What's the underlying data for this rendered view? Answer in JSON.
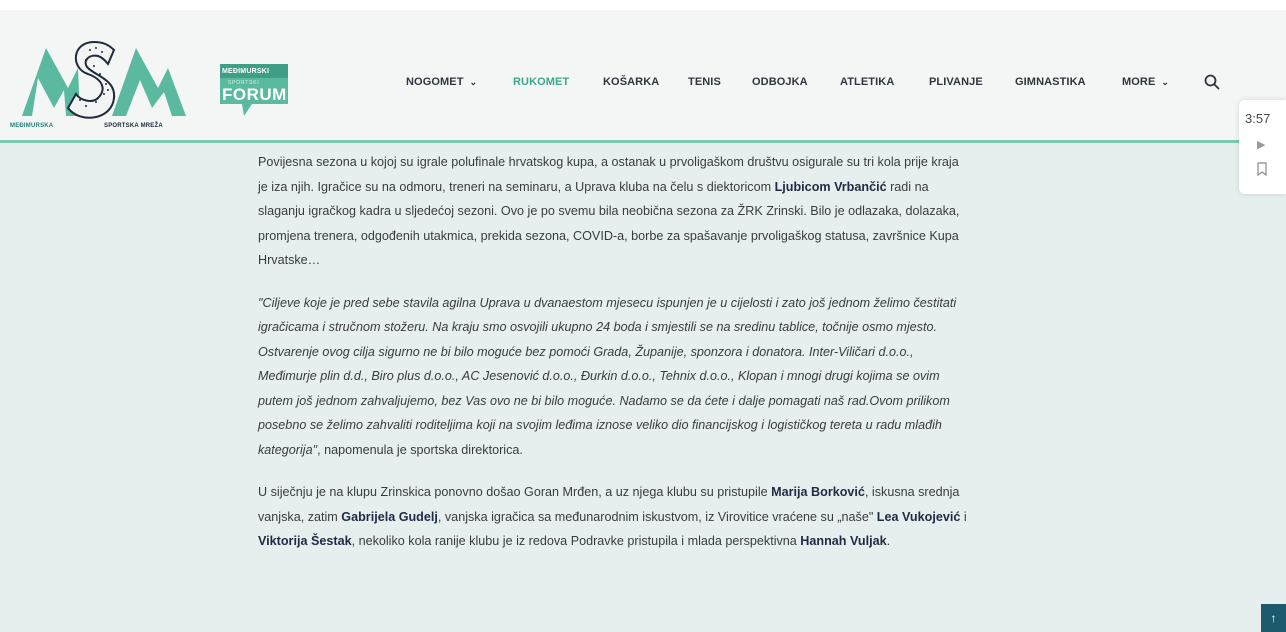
{
  "header": {
    "logo": {
      "left_text": "MEĐIMURSKA",
      "right_text": "SPORTSKA MREŽA",
      "letters": "MSM"
    },
    "forum_logo": {
      "top_text": "MEĐIMURSKI",
      "sub_text": "SPORTSKI",
      "main_text": "FORUM"
    },
    "nav": [
      {
        "label": "NOGOMET",
        "dropdown": true
      },
      {
        "label": "RUKOMET",
        "active": true
      },
      {
        "label": "KOŠARKA"
      },
      {
        "label": "TENIS"
      },
      {
        "label": "ODBOJKA"
      },
      {
        "label": "ATLETIKA"
      },
      {
        "label": "PLIVANJE"
      },
      {
        "label": "GIMNASTIKA"
      },
      {
        "label": "MORE",
        "dropdown": true
      }
    ],
    "search_icon": "search-icon"
  },
  "side_widget": {
    "time": "3:57",
    "play_icon": "play-icon",
    "bookmark_icon": "bookmark-icon"
  },
  "article": {
    "p1": {
      "t1": "Povijesna sezona u kojoj su igrale polufinale hrvatskog kupa, a ostanak u prvoligaškom društvu osigurale su tri kola prije kraja je iza njih. Igračice su na odmoru, treneri na seminaru, a Uprava kluba na čelu s diektoricom ",
      "b1": "Ljubicom Vrbančić",
      "t2": " radi na slaganju igračkog kadra u sljedećoj sezoni. Ovo je po svemu bila neobična sezona za ŽRK Zrinski. Bilo je odlazaka, dolazaka, promjena trenera, odgođenih utakmica, prekida sezona, COVID-a, borbe za spašavanje prvoligaškog statusa, završnice Kupa Hrvatske…"
    },
    "quote": "\"Ciljeve koje je pred sebe stavila agilna Uprava u dvanaestom mjesecu ispunjen je u cijelosti i zato još jednom želimo čestitati igračicama i stručnom stožeru. Na kraju smo osvojili ukupno 24 boda i smjestili se na sredinu tablice, točnije osmo mjesto. Ostvarenje ovog cilja sigurno ne bi bilo moguće bez pomoći Grada, Županije, sponzora i donatora. Inter-Viličari d.o.o., Međimurje plin d.d., Biro plus d.o.o., AC Jesenović d.o.o., Đurkin d.o.o., Tehnix d.o.o., Klopan i mnogi drugi kojima se ovim putem još jednom zahvaljujemo, bez Vas ovo ne bi bilo moguće. Nadamo se da ćete i dalje pomagati naš rad.Ovom prilikom posebno se želimo zahvaliti roditeljima koji na svojim leđima iznose veliko dio financijskog i logističkog tereta u radu mlađih kategorija\"",
    "quote_tail": ", napomenula je sportska direktorica.",
    "p3": {
      "t1": "U siječnju je na klupu Zrinskica ponovno došao Goran Mrđen, a uz njega klubu su pristupile ",
      "b1": "Marija Borković",
      "t2": ", iskusna srednja vanjska, zatim ",
      "b2": "Gabrijela Gudelj",
      "t3": ", vanjska igračica sa međunarodnim iskustvom, iz Virovitice vraćene su „naše\" ",
      "b3": "Lea Vukojević",
      "t4": " i ",
      "b4": "Viktorija Šestak",
      "t5": ", nekoliko kola ranije klubu je iz redova Podravke pristupila i mlada perspektivna ",
      "b5": "Hannah Vuljak",
      "t6": "."
    }
  },
  "back_to_top_icon": "arrow-up-icon",
  "colors": {
    "accent": "#3aa88a",
    "header_border": "#7ccab6",
    "page_bg": "#e6efed",
    "back_to_top": "#1e5a6e"
  }
}
